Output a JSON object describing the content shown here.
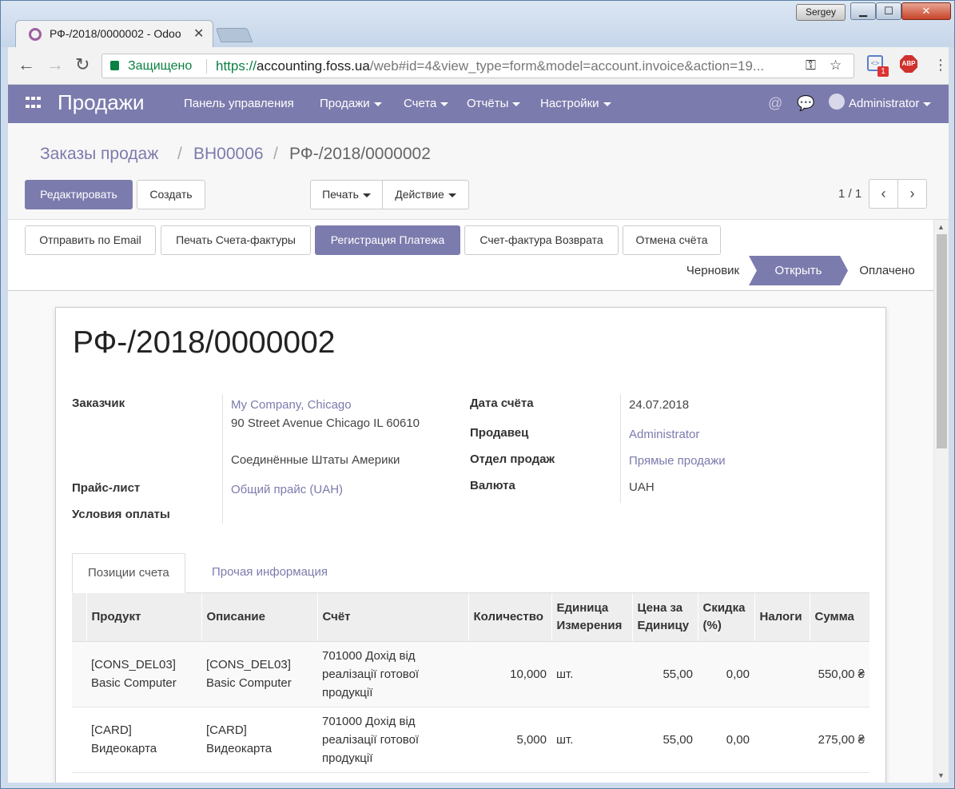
{
  "browser": {
    "tab_title": "РФ-/2018/0000002 - Odoo",
    "tab_close": "✕",
    "profile": "Sergey",
    "win_min": "▁",
    "win_max": "☐",
    "win_close": "✕",
    "secure_label": "Защищено",
    "url_scheme": "https://",
    "url_host": "accounting.foss.ua",
    "url_path": "/web#id=4&view_type=form&model=account.invoice&action=19...",
    "ext_badge": "1",
    "ext_label": "<>",
    "abp_label": "ABP"
  },
  "navbar": {
    "brand": "Продажи",
    "menus": [
      "Панель управления",
      "Продажи",
      "Счета",
      "Отчёты",
      "Настройки"
    ],
    "user": "Administrator"
  },
  "breadcrumb": [
    "Заказы продаж",
    "ВН00006",
    "РФ-/2018/0000002"
  ],
  "buttons": {
    "edit": "Редактировать",
    "create": "Создать",
    "print": "Печать",
    "action": "Действие"
  },
  "pager": "1 / 1",
  "header_buttons": [
    "Отправить по Email",
    "Печать Счета-фактуры",
    "Регистрация Платежа",
    "Счет-фактура Возврата",
    "Отмена счёта"
  ],
  "stages": {
    "draft": "Черновик",
    "open": "Открыть",
    "paid": "Оплачено",
    "current": "open"
  },
  "invoice": {
    "title": "РФ-/2018/0000002",
    "customer_label": "Заказчик",
    "customer_name": "My Company, Chicago",
    "customer_street": "90 Street Avenue Chicago IL 60610",
    "customer_country": "Соединённые Штаты Америки",
    "pricelist_label": "Прайс-лист",
    "pricelist": "Общий прайс (UAH)",
    "payment_terms_label": "Условия оплаты",
    "date_label": "Дата счёта",
    "date": "24.07.2018",
    "salesperson_label": "Продавец",
    "salesperson": "Administrator",
    "team_label": "Отдел продаж",
    "team": "Прямые продажи",
    "currency_label": "Валюта",
    "currency": "UAH"
  },
  "tabs": [
    "Позиции счета",
    "Прочая информация"
  ],
  "lines": {
    "columns": [
      "Продукт",
      "Описание",
      "Счёт",
      "Количество",
      "Единица Измерения",
      "Цена за Единицу",
      "Скидка (%)",
      "Налоги",
      "Сумма"
    ],
    "rows": [
      {
        "product": "[CONS_DEL03] Basic Computer",
        "description": "[CONS_DEL03] Basic Computer",
        "account": "701000 Дохід від реалізації готової продукції",
        "qty": "10,000",
        "uom": "шт.",
        "price": "55,00",
        "discount": "0,00",
        "taxes": "",
        "subtotal": "550,00 ₴"
      },
      {
        "product": "[CARD] Видеокарта",
        "description": "[CARD] Видеокарта",
        "account": "701000 Дохід від реалізації готової продукції",
        "qty": "5,000",
        "uom": "шт.",
        "price": "55,00",
        "discount": "0,00",
        "taxes": "",
        "subtotal": "275,00 ₴"
      }
    ]
  },
  "colors": {
    "accent": "#7c7bad",
    "secure_green": "#0b8043"
  }
}
